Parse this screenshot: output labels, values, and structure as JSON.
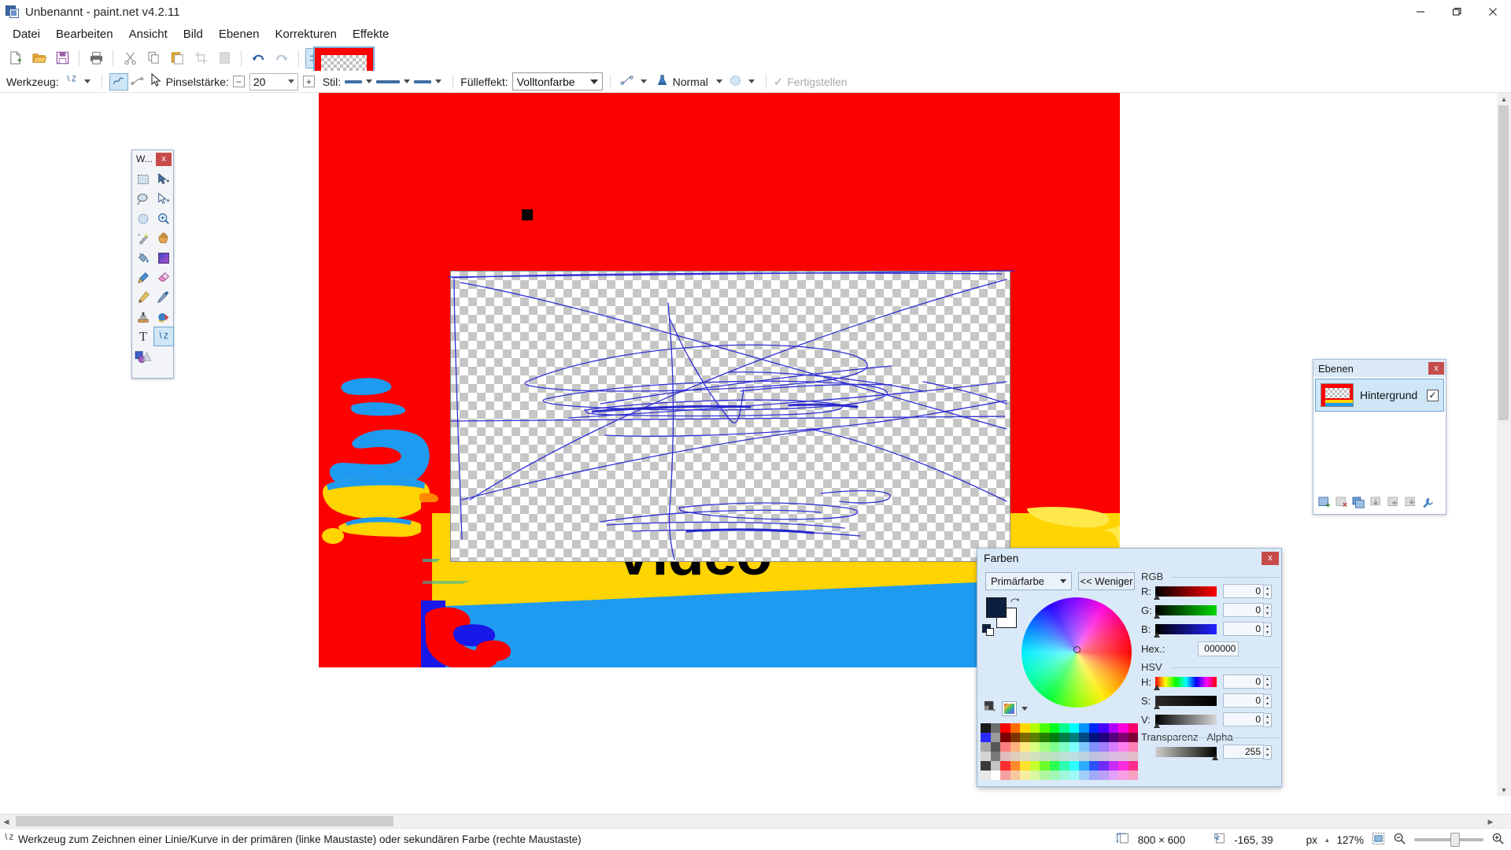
{
  "app": {
    "title": "Unbenannt - paint.net v4.2.11",
    "icon": "paintnet-icon"
  },
  "window_controls": {
    "minimize": "minimize-icon",
    "maximize": "maximize-icon",
    "close": "close-icon"
  },
  "title_tools": [
    {
      "name": "tools-window-toggle",
      "icon": "hammer-icon",
      "active": true
    },
    {
      "name": "history-window-toggle",
      "icon": "history-icon",
      "active": false
    },
    {
      "name": "layers-window-toggle",
      "icon": "layers-icon",
      "active": true
    },
    {
      "name": "colors-window-toggle",
      "icon": "color-wheel-icon",
      "active": true
    },
    {
      "name": "settings-button",
      "icon": "gear-icon",
      "active": false
    },
    {
      "name": "help-button",
      "icon": "help-icon",
      "active": false
    }
  ],
  "menu": {
    "items": [
      {
        "label": "Datei"
      },
      {
        "label": "Bearbeiten"
      },
      {
        "label": "Ansicht"
      },
      {
        "label": "Bild"
      },
      {
        "label": "Ebenen"
      },
      {
        "label": "Korrekturen"
      },
      {
        "label": "Effekte"
      }
    ]
  },
  "toolbar": {
    "buttons": [
      {
        "name": "new-button",
        "icon": "new-file-icon"
      },
      {
        "name": "open-button",
        "icon": "open-folder-icon"
      },
      {
        "name": "save-button",
        "icon": "save-disk-icon"
      },
      {
        "name": "print-button",
        "icon": "printer-icon"
      },
      {
        "name": "cut-button",
        "icon": "scissors-icon"
      },
      {
        "name": "copy-button",
        "icon": "copy-icon"
      },
      {
        "name": "paste-button",
        "icon": "paste-icon"
      },
      {
        "name": "crop-button",
        "icon": "crop-icon"
      },
      {
        "name": "deselect-button",
        "icon": "deselect-icon"
      },
      {
        "name": "undo-button",
        "icon": "undo-arrow-icon"
      },
      {
        "name": "redo-button",
        "icon": "redo-arrow-icon"
      },
      {
        "name": "grid-button",
        "icon": "grid-icon"
      },
      {
        "name": "rulers-button",
        "icon": "ruler-icon"
      }
    ]
  },
  "tool_options": {
    "tool_label": "Werkzeug:",
    "tool_icon": "line-curve-icon",
    "mode_line_icon": "draw-line-icon",
    "mode_curve_icon": "draw-curve-icon",
    "cursor_icon": "mouse-cursor-icon",
    "brush_label": "Pinselstärke:",
    "brush_value": "20",
    "minus_label": "−",
    "plus_label": "+",
    "style_label": "Stil:",
    "fill_label": "Fülleffekt:",
    "fill_value": "Volltonfarbe",
    "blend_label": "Normal",
    "antialias_icon": "antialias-icon",
    "finish_label": "Fertigstellen",
    "finish_icon": "check-icon"
  },
  "tools_window": {
    "title": "W...",
    "close_label": "x",
    "tools": [
      {
        "name": "rectangle-select-tool",
        "icon": "rectangle-select-icon",
        "selected": false
      },
      {
        "name": "move-selected-tool",
        "icon": "move-selected-icon",
        "selected": false
      },
      {
        "name": "lasso-select-tool",
        "icon": "lasso-select-icon",
        "selected": false
      },
      {
        "name": "move-selection-tool",
        "icon": "move-selection-icon",
        "selected": false
      },
      {
        "name": "ellipse-select-tool",
        "icon": "ellipse-select-icon",
        "selected": false
      },
      {
        "name": "zoom-tool",
        "icon": "magnifier-icon",
        "selected": false
      },
      {
        "name": "magic-wand-tool",
        "icon": "magic-wand-icon",
        "selected": false
      },
      {
        "name": "pan-tool",
        "icon": "hand-icon",
        "selected": false
      },
      {
        "name": "paint-bucket-tool",
        "icon": "paint-bucket-icon",
        "selected": false
      },
      {
        "name": "gradient-tool",
        "icon": "gradient-icon",
        "selected": false
      },
      {
        "name": "paintbrush-tool",
        "icon": "paintbrush-icon",
        "selected": false
      },
      {
        "name": "eraser-tool",
        "icon": "eraser-icon",
        "selected": false
      },
      {
        "name": "pencil-tool",
        "icon": "pencil-icon",
        "selected": false
      },
      {
        "name": "color-picker-tool",
        "icon": "eyedropper-icon",
        "selected": false
      },
      {
        "name": "clone-stamp-tool",
        "icon": "clone-stamp-icon",
        "selected": false
      },
      {
        "name": "recolor-tool",
        "icon": "recolor-icon",
        "selected": false
      },
      {
        "name": "text-tool",
        "icon": "text-T-icon",
        "selected": false
      },
      {
        "name": "line-curve-tool",
        "icon": "line-curve-icon",
        "selected": true
      },
      {
        "name": "shapes-tool",
        "icon": "shapes-icon",
        "selected": false
      }
    ]
  },
  "layers_panel": {
    "title": "Ebenen",
    "close_label": "x",
    "rows": [
      {
        "name": "Hintergrund",
        "visible": true,
        "checkmark": "✓"
      }
    ],
    "footer_buttons": [
      {
        "name": "add-layer-button",
        "icon": "add-layer-icon"
      },
      {
        "name": "delete-layer-button",
        "icon": "delete-layer-icon"
      },
      {
        "name": "duplicate-layer-button",
        "icon": "duplicate-layer-icon"
      },
      {
        "name": "merge-layer-down-button",
        "icon": "merge-down-icon"
      },
      {
        "name": "move-layer-up-button",
        "icon": "move-up-icon"
      },
      {
        "name": "move-layer-down-button",
        "icon": "move-down-icon"
      },
      {
        "name": "layer-properties-button",
        "icon": "wrench-icon"
      }
    ]
  },
  "colors_dialog": {
    "title": "Farben",
    "close_label": "x",
    "palette_select": "Primärfarbe",
    "less_button": "<< Weniger",
    "primary_color": "#0b1f3f",
    "secondary_color": "#ffffff",
    "swap_icon": "swap-colors-icon",
    "palette_icons": [
      {
        "name": "add-color-button",
        "icon": "add-swatch-icon"
      },
      {
        "name": "palette-preset-button",
        "icon": "palette-icon"
      }
    ],
    "rgb": {
      "group_label": "RGB",
      "fields": [
        {
          "label": "R:",
          "value": "0",
          "track": "red"
        },
        {
          "label": "G:",
          "value": "0",
          "track": "green"
        },
        {
          "label": "B:",
          "value": "0",
          "track": "blue"
        }
      ],
      "hex_label": "Hex.:",
      "hex_value": "000000"
    },
    "hsv": {
      "group_label": "HSV",
      "fields": [
        {
          "label": "H:",
          "value": "0",
          "track": "hue"
        },
        {
          "label": "S:",
          "value": "0",
          "track": "sat"
        },
        {
          "label": "V:",
          "value": "0",
          "track": "val"
        }
      ]
    },
    "alpha": {
      "group_label": "Transparenz - Alpha",
      "value": "255"
    }
  },
  "statusbar": {
    "tool_icon": "line-curve-icon",
    "help_text": "Werkzeug zum Zeichnen einer Linie/Kurve in der primären (linke Maustaste) oder sekundären Farbe (rechte Maustaste)",
    "image_size_icon": "image-size-icon",
    "image_size": "800 × 600",
    "cursor_pos_icon": "cursor-position-icon",
    "cursor_pos": "-165, 39",
    "unit": "px",
    "unit_caret": "▴",
    "zoom_level": "127%",
    "fit_icon": "fit-to-window-icon",
    "zoom_out_icon": "zoom-out-icon",
    "zoom_in_icon": "zoom-in-icon"
  },
  "canvas": {
    "background_color": "#fd0000",
    "band_yellow": "#ffd400",
    "band_blue": "#1e9bf0",
    "video_text": "Video",
    "scribble_color": "#2a2ad0",
    "black_marker_color": "#060606"
  }
}
